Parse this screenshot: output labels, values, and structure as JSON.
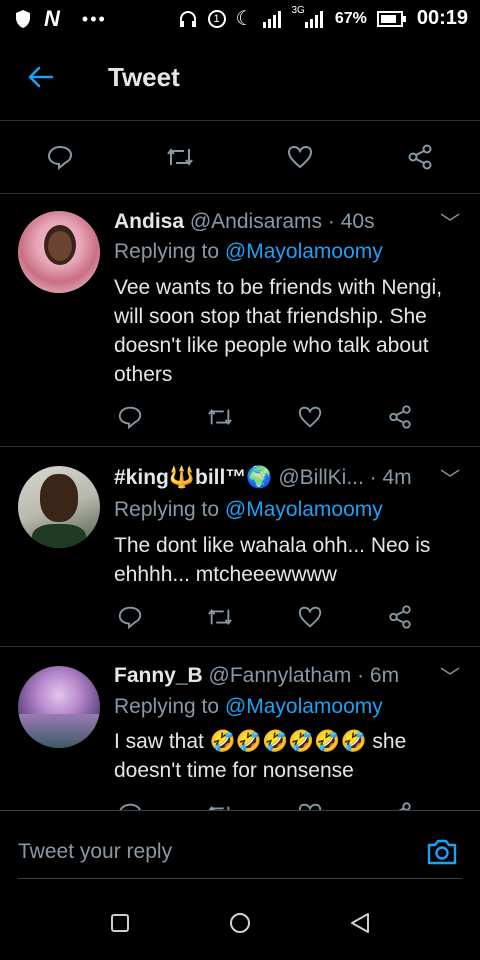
{
  "status": {
    "battery_pct": "67%",
    "time": "00:19",
    "network_label": "3G",
    "sim_label": "1"
  },
  "header": {
    "title": "Tweet"
  },
  "tweets": [
    {
      "name": "Andisa",
      "handle": "@Andisarams",
      "time": "· 40s",
      "replying_prefix": "Replying to",
      "replying_to": "@Mayolamoomy",
      "text": "Vee wants to be friends with Nengi, will soon stop that friendship. She doesn't like people who talk about others"
    },
    {
      "name": "#king🔱bill™🌍",
      "handle": "@BillKi...",
      "time": "· 4m",
      "replying_prefix": "Replying to",
      "replying_to": "@Mayolamoomy",
      "text": "The dont like wahala ohh... Neo is ehhhh... mtcheeewwww"
    },
    {
      "name": "Fanny_B",
      "handle": "@Fannylatham",
      "time": "· 6m",
      "replying_prefix": "Replying to",
      "replying_to": "@Mayolamoomy",
      "text": "I saw that 🤣🤣🤣🤣🤣🤣 she doesn't time for nonsense"
    }
  ],
  "composer": {
    "placeholder": "Tweet your reply"
  },
  "colors": {
    "accent": "#1da1f2",
    "muted": "#8899a6",
    "background": "#000000"
  }
}
